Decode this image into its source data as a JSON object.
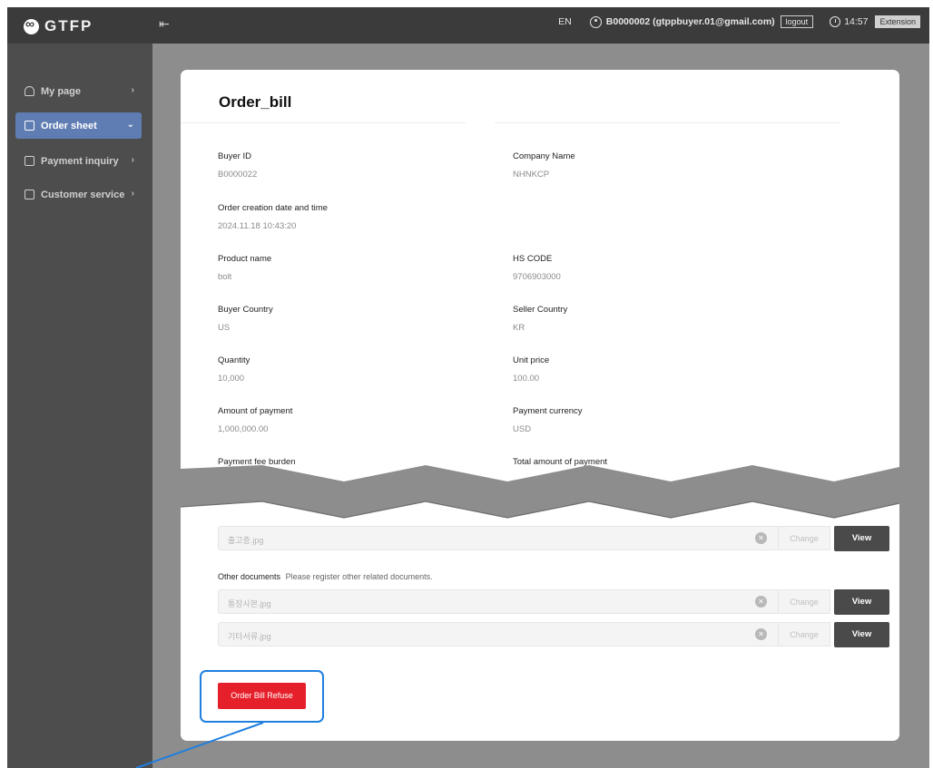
{
  "topbar": {
    "logo_text": "GTFP",
    "menu_toggle_icon": "menu-collapse-icon",
    "language": "EN",
    "user": "B0000002 (gtppbuyer.01@gmail.com)",
    "logout_label": "logout",
    "time": "14:57",
    "extension_label": "Extension"
  },
  "sidebar": {
    "items": [
      {
        "label": "My page",
        "icon": "person-icon"
      },
      {
        "label": "Order sheet",
        "icon": "document-icon"
      },
      {
        "label": "Payment inquiry",
        "icon": "clipboard-icon"
      },
      {
        "label": "Customer service",
        "icon": "grid-icon"
      }
    ]
  },
  "card": {
    "title": "Order_bill",
    "fields": [
      {
        "label": "Buyer ID",
        "value": "B0000022"
      },
      {
        "label": "Company Name",
        "value": "NHNKCP"
      },
      {
        "label": "Order creation date and time",
        "value": "2024.11.18 10:43:20"
      },
      {
        "label": "Product name",
        "value": "bolt"
      },
      {
        "label": "HS CODE",
        "value": "9706903000"
      },
      {
        "label": "Buyer Country",
        "value": "US"
      },
      {
        "label": "Seller Country",
        "value": "KR"
      },
      {
        "label": "Quantity",
        "value": "10,000"
      },
      {
        "label": "Unit price",
        "value": "100.00"
      },
      {
        "label": "Amount of payment",
        "value": "1,000,000.00"
      },
      {
        "label": "Payment currency",
        "value": "USD"
      },
      {
        "label": "Payment fee burden",
        "value": ""
      },
      {
        "label": "Total amount of payment",
        "value": ""
      }
    ],
    "files": [
      {
        "name": "출고증.jpg",
        "change_label": "Change",
        "view_label": "View"
      },
      {
        "name": "통장사본.jpg",
        "change_label": "Change",
        "view_label": "View"
      },
      {
        "name": "기타서류.jpg",
        "change_label": "Change",
        "view_label": "View"
      }
    ],
    "other_documents_label": "Other documents",
    "other_documents_hint": "Please register other related documents.",
    "refuse_label": "Order Bill Refuse"
  },
  "colors": {
    "topbar": "#3b3b3b",
    "sidebar": "#4d4d4d",
    "sidebar_active": "#5f7db3",
    "refuse_button": "#e6202b",
    "annotation": "#1f7fe0"
  }
}
